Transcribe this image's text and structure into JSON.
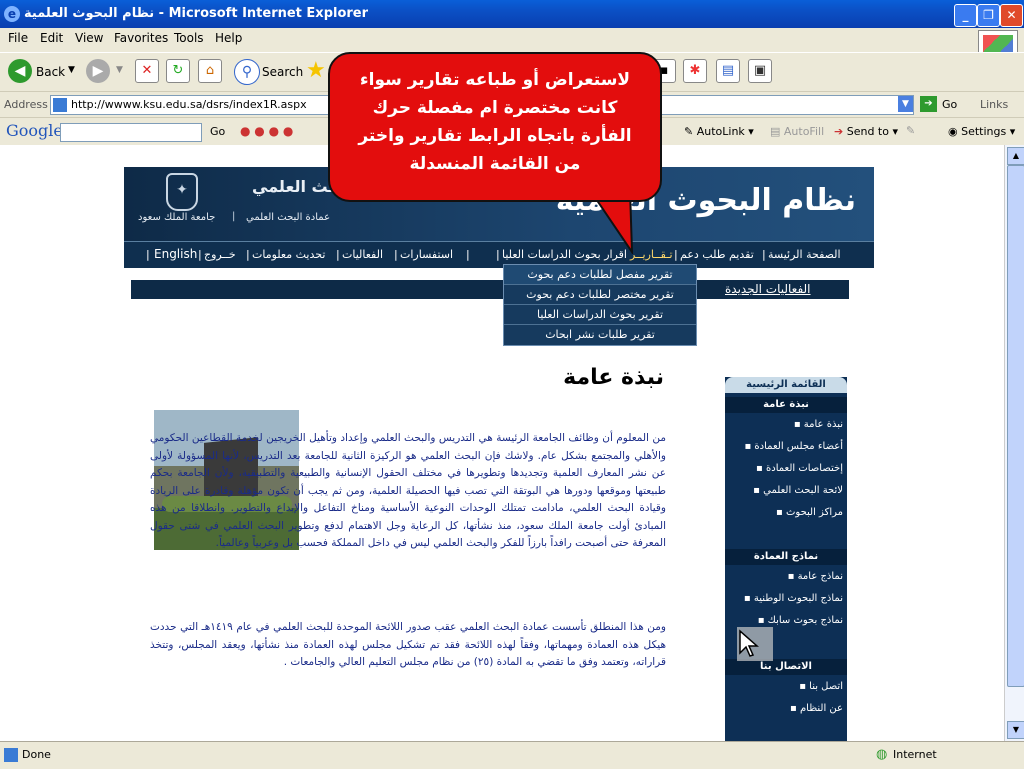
{
  "window": {
    "title": "نظام البحوث العلمية - Microsoft Internet Explorer",
    "minimize": "_",
    "maximize": "❐",
    "close": "✕"
  },
  "menu": [
    "File",
    "Edit",
    "View",
    "Favorites",
    "Tools",
    "Help"
  ],
  "toolbar": {
    "back": "Back",
    "search": "Search"
  },
  "address": {
    "label": "Address",
    "url": "http://wwww.ksu.edu.sa/dsrs/index1R.aspx",
    "go": "Go",
    "links": "Links"
  },
  "googlebar": {
    "brand": "Google",
    "go": "Go",
    "autolink": "AutoLink",
    "autofill": "AutoFill",
    "sendto": "Send to",
    "settings": "Settings"
  },
  "site": {
    "logo_title": "نظام البحوث العلمية",
    "university": "جامعة الملك سعود",
    "deanship": "عمادة البحث العلمي",
    "emblem_text": "البحث العلمي",
    "nav": [
      "الصفحة الرئيسة",
      "تقديم طلب دعم",
      "اقرار بحوث الدراسات العليا",
      "تـقــاريــر",
      "استفسارات",
      "الفعاليات",
      "تحديث معلومات",
      "خــروج",
      "English"
    ],
    "news_title": "الفعاليات الجديدة",
    "dropdown": [
      "تقرير مفصل لطلبات دعم بحوث",
      "تقرير مختصر لطلبات دعم بحوث",
      "تقرير بحوث الدراسات العليا",
      "تقرير طلبات نشر ابحاث"
    ],
    "section_title": "نبذة عامة",
    "paragraph1": "من المعلوم أن وظائف الجامعة الرئيسة هي التدريس والبحث العلمي وإعداد وتأهيل الخريجين لخدمة القطاعين الحكومي والأهلي والمجتمع بشكل عام. ولاشك فإن البحث العلمي هو الركيزة الثانية للجامعة بعد التدريس، لأنها المسؤولة لأولى عن نشر المعارف العلمية وتجديدها وتطويرها في مختلف الحقول الإنسانية والطبيعية والتطبيقية، ولأن الجامعة بحكم طبيعتها وموقعها ودورها هي البوتقة التي تصب فيها الحصيلة العلمية، ومن ثم يجب أن تكون مؤهلة وقادرة على الريادة وقيادة البحث العلمي، مادامت تمتلك الوحدات النوعية الأساسية ومناخ التفاعل والإبداع والتطوير. وانطلاقا من هذه المبادئ أولت جامعة الملك سعود، منذ نشأتها، كل الرعاية وجل الاهتمام لدفع وتطوير البحث العلمي في شتى حقول المعرفة حتى أصبحت رافداً بارزاً للفكر والبحث العلمي ليس في داخل المملكة فحسب بل وعربياً وعالمياً.",
    "paragraph2": "ومن هذا المنطلق تأسست عمادة البحث العلمي عقب صدور اللائحة الموحدة للبحث العلمي في عام ١٤١٩هـ التي حددت هيكل هذه العمادة ومهماتها، وفقاً لهذه اللائحة فقد تم تشكيل مجلس لهذه العمادة منذ نشأتها، ويعقد المجلس، وتتخذ قراراته، وتعتمد وفق ما تقضي به المادة (٢٥) من نظام مجلس التعليم العالي والجامعات ."
  },
  "sidebar": {
    "main_menu": "القائمة الرئيسية",
    "section1": "نبذة عامة",
    "items1": [
      "نبذة عامة",
      "أعضاء مجلس العمادة",
      "إختصاصات العمادة",
      "لائحة البحث العلمي",
      "مراكز البحوث"
    ],
    "section2": "نماذج العمادة",
    "items2": [
      "نماذج عامة",
      "نماذج البحوث الوطنية",
      "نماذج بحوث سابك"
    ],
    "section3": "الاتصال بنا",
    "items3": [
      "اتصل بنا",
      "عن النظام"
    ]
  },
  "callout": "لاستعراض أو طباعه تقارير سواء كانت مختصرة ام مفصلة حرك الفأرة باتجاه الرابط تقارير واختر من القائمة المنسدلة",
  "status": {
    "done": "Done",
    "zone": "Internet"
  },
  "colors": {
    "ie_blue": "#0b4fc4",
    "site_navy": "#0f2f4f",
    "callout_red": "#e30d0d",
    "paragraph_text": "#1a2b88"
  }
}
